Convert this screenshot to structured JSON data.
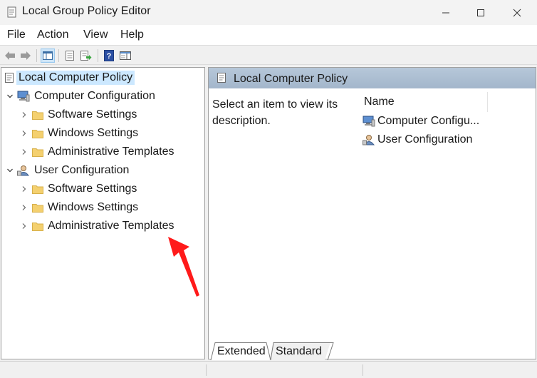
{
  "window": {
    "title": "Local Group Policy Editor",
    "icons": {
      "app": "policy-editor-icon",
      "minimize": "minimize-icon",
      "maximize": "maximize-icon",
      "close": "close-icon"
    }
  },
  "menu": [
    "File",
    "Action",
    "View",
    "Help"
  ],
  "toolbar": [
    "back-icon",
    "forward-icon",
    "show-hide-tree-icon",
    "properties-icon",
    "export-list-icon",
    "help-icon",
    "show-hide-action-pane-icon"
  ],
  "tree": {
    "root": "Local Computer Policy",
    "computer_config": {
      "label": "Computer Configuration",
      "children": [
        "Software Settings",
        "Windows Settings",
        "Administrative Templates"
      ]
    },
    "user_config": {
      "label": "User Configuration",
      "children": [
        "Software Settings",
        "Windows Settings",
        "Administrative Templates"
      ]
    }
  },
  "details": {
    "header": "Local Computer Policy",
    "description": "Select an item to view its description.",
    "column_name": "Name",
    "items": [
      "Computer Configu...",
      "User Configuration"
    ]
  },
  "tabs": [
    "Extended",
    "Standard"
  ],
  "colors": {
    "selection": "#cce8ff",
    "header": "#aabdd2",
    "annotation_arrow": "#ff1a1a",
    "folder": "#f4d06f"
  }
}
